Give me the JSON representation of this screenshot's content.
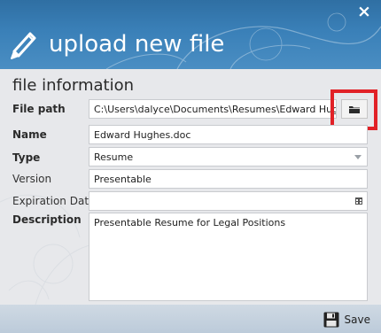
{
  "dialog": {
    "title": "upload new file",
    "close_symbol": "×"
  },
  "form": {
    "section_title": "file information",
    "fields": {
      "file_path": {
        "label": "File path",
        "value": "C:\\Users\\dalyce\\Documents\\Resumes\\Edward Hughes.doc"
      },
      "name": {
        "label": "Name",
        "value": "Edward Hughes.doc"
      },
      "type": {
        "label": "Type",
        "value": "Resume"
      },
      "version": {
        "label": "Version",
        "value": "Presentable"
      },
      "expiration_date": {
        "label": "Expiration Date",
        "value": ""
      },
      "description": {
        "label": "Description",
        "value": "Presentable Resume for Legal Positions"
      }
    }
  },
  "footer": {
    "save_label": "Save"
  },
  "icons": {
    "header": "pencil-icon",
    "close": "close-icon",
    "browse": "folder-icon",
    "date": "calendar-icon",
    "save": "floppy-disk-icon",
    "dropdown": "chevron-down-icon"
  },
  "colors": {
    "header": "#3a80b8",
    "highlight": "#e12127",
    "footer": "#c6d3df"
  }
}
